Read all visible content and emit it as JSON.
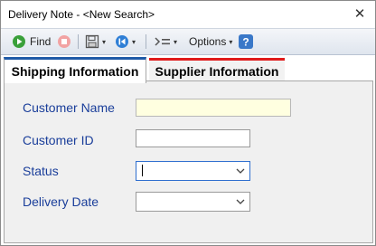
{
  "window": {
    "title": "Delivery Note - <New Search>",
    "close_glyph": "✕"
  },
  "toolbar": {
    "find_label": "Find",
    "options_label": "Options",
    "icons": [
      "find-icon",
      "stop-icon",
      "save-icon",
      "previous-icon",
      "filter-icon",
      "help-icon"
    ]
  },
  "tabs": [
    {
      "label": "Shipping Information",
      "active": true,
      "accent": "#1e5aa8"
    },
    {
      "label": "Supplier Information",
      "active": false,
      "accent": "#e01b1b"
    }
  ],
  "form": {
    "customer_name": {
      "label": "Customer Name",
      "value": ""
    },
    "customer_id": {
      "label": "Customer ID",
      "value": ""
    },
    "status": {
      "label": "Status",
      "value": ""
    },
    "delivery_date": {
      "label": "Delivery Date",
      "value": ""
    }
  },
  "colors": {
    "label_color": "#1a3e9a",
    "required_field_bg": "#ffffe0"
  }
}
